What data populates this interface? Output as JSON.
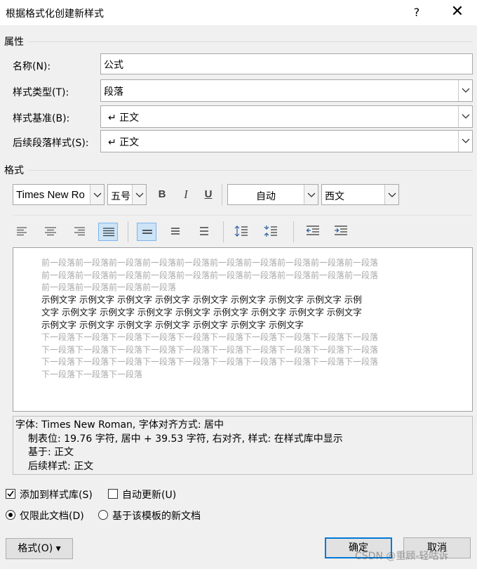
{
  "window": {
    "title": "根据格式化创建新样式",
    "help_label": "?",
    "close_label": "✕"
  },
  "properties": {
    "group_label": "属性",
    "name_label": "名称(N):",
    "name_value": "公式",
    "style_type_label": "样式类型(T):",
    "style_type_value": "段落",
    "based_on_label": "样式基准(B):",
    "based_on_value": "↵ 正文",
    "following_label": "后续段落样式(S):",
    "following_value": "↵ 正文"
  },
  "formatting": {
    "group_label": "格式",
    "font": "Times New Ro",
    "size": "五号",
    "bold_label": "B",
    "italic_label": "I",
    "underline_label": "U",
    "color": "自动",
    "script": "西文",
    "selected_alignment": "center",
    "selected_line_spacing": "single"
  },
  "preview": {
    "prev_lines": [
      "前一段落前一段落前一段落前一段落前一段落前一段落前一段落前一段落前一段落前一段落",
      "前一段落前一段落前一段落前一段落前一段落前一段落前一段落前一段落前一段落前一段落",
      "前一段落前一段落前一段落前一段落"
    ],
    "sample_lines": [
      "示例文字 示例文字 示例文字 示例文字 示例文字 示例文字 示例文字 示例文字 示例",
      "文字 示例文字 示例文字 示例文字 示例文字 示例文字 示例文字 示例文字 示例文字",
      "示例文字 示例文字 示例文字 示例文字 示例文字 示例文字 示例文字"
    ],
    "next_lines": [
      "下一段落下一段落下一段落下一段落下一段落下一段落下一段落下一段落下一段落下一段落",
      "下一段落下一段落下一段落下一段落下一段落下一段落下一段落下一段落下一段落下一段落",
      "下一段落下一段落下一段落下一段落下一段落下一段落下一段落下一段落下一段落下一段落",
      "下一段落下一段落下一段落"
    ]
  },
  "description": {
    "line1": "字体: Times New Roman, 字体对齐方式: 居中",
    "line2": "制表位:  19.76 字符, 居中 +  39.53 字符, 右对齐, 样式: 在样式库中显示",
    "line3": "基于: 正文",
    "line4": "后续样式: 正文"
  },
  "options": {
    "add_to_gallery_label": "添加到样式库(S)",
    "add_to_gallery_checked": true,
    "auto_update_label": "自动更新(U)",
    "auto_update_checked": false,
    "this_doc_label": "仅限此文档(D)",
    "template_label": "基于该模板的新文档",
    "selected_scope": "this_document"
  },
  "buttons": {
    "format_label": "格式(O) ▾",
    "ok_label": "确定",
    "cancel_label": "取消"
  },
  "watermark": "CSDN @重顾-轻咕诉"
}
